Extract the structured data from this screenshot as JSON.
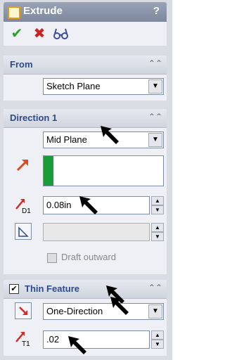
{
  "window": {
    "title": "Extrude",
    "help": "?"
  },
  "toolbar": {
    "ok_icon": "check-icon",
    "cancel_icon": "x-icon",
    "preview_icon": "glasses-icon"
  },
  "from": {
    "title": "From",
    "value": "Sketch Plane"
  },
  "direction1": {
    "title": "Direction 1",
    "end_condition": "Mid Plane",
    "depth": "0.08in",
    "draft_outward": "Draft outward"
  },
  "thin": {
    "title": "Thin Feature",
    "type": "One-Direction",
    "thickness": ".02",
    "checked": true
  },
  "colors": {
    "accent": "#2e4a8a",
    "preview_fill": "#1b9c3a"
  }
}
